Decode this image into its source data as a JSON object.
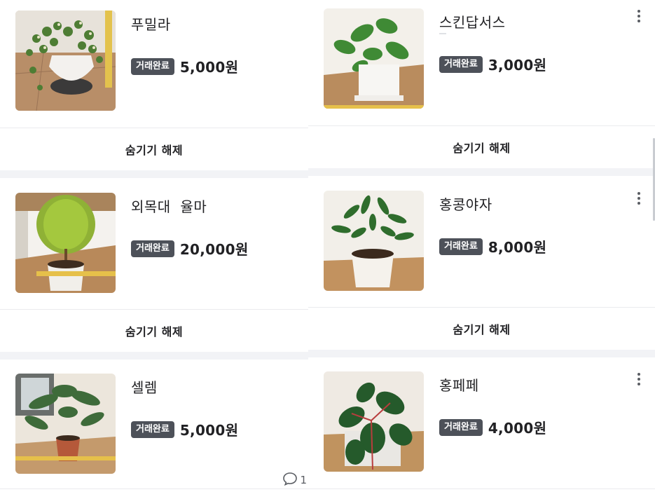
{
  "left_column": {
    "items": [
      {
        "title": "푸밀라",
        "badge": "거래완료",
        "price": "5,000원",
        "action": "숨기기 해제"
      },
      {
        "title": "외목대  율마",
        "badge": "거래완료",
        "price": "20,000원",
        "action": "숨기기 해제"
      },
      {
        "title": "셀렘",
        "badge": "거래완료",
        "price": "5,000원",
        "chat_count": "1"
      }
    ]
  },
  "right_column": {
    "items": [
      {
        "title": "스킨답서스",
        "badge": "거래완료",
        "price": "3,000원",
        "action": "숨기기 해제"
      },
      {
        "title": "홍콩야자",
        "badge": "거래완료",
        "price": "8,000원",
        "action": "숨기기 해제"
      },
      {
        "title": "홍페페",
        "badge": "거래완료",
        "price": "4,000원"
      }
    ]
  },
  "icons": {
    "more": "more-vertical-icon",
    "chat": "chat-bubble-icon"
  },
  "colors": {
    "badge_bg": "#4d5159",
    "section_gap": "#f2f3f6",
    "divider": "#eaebee"
  }
}
